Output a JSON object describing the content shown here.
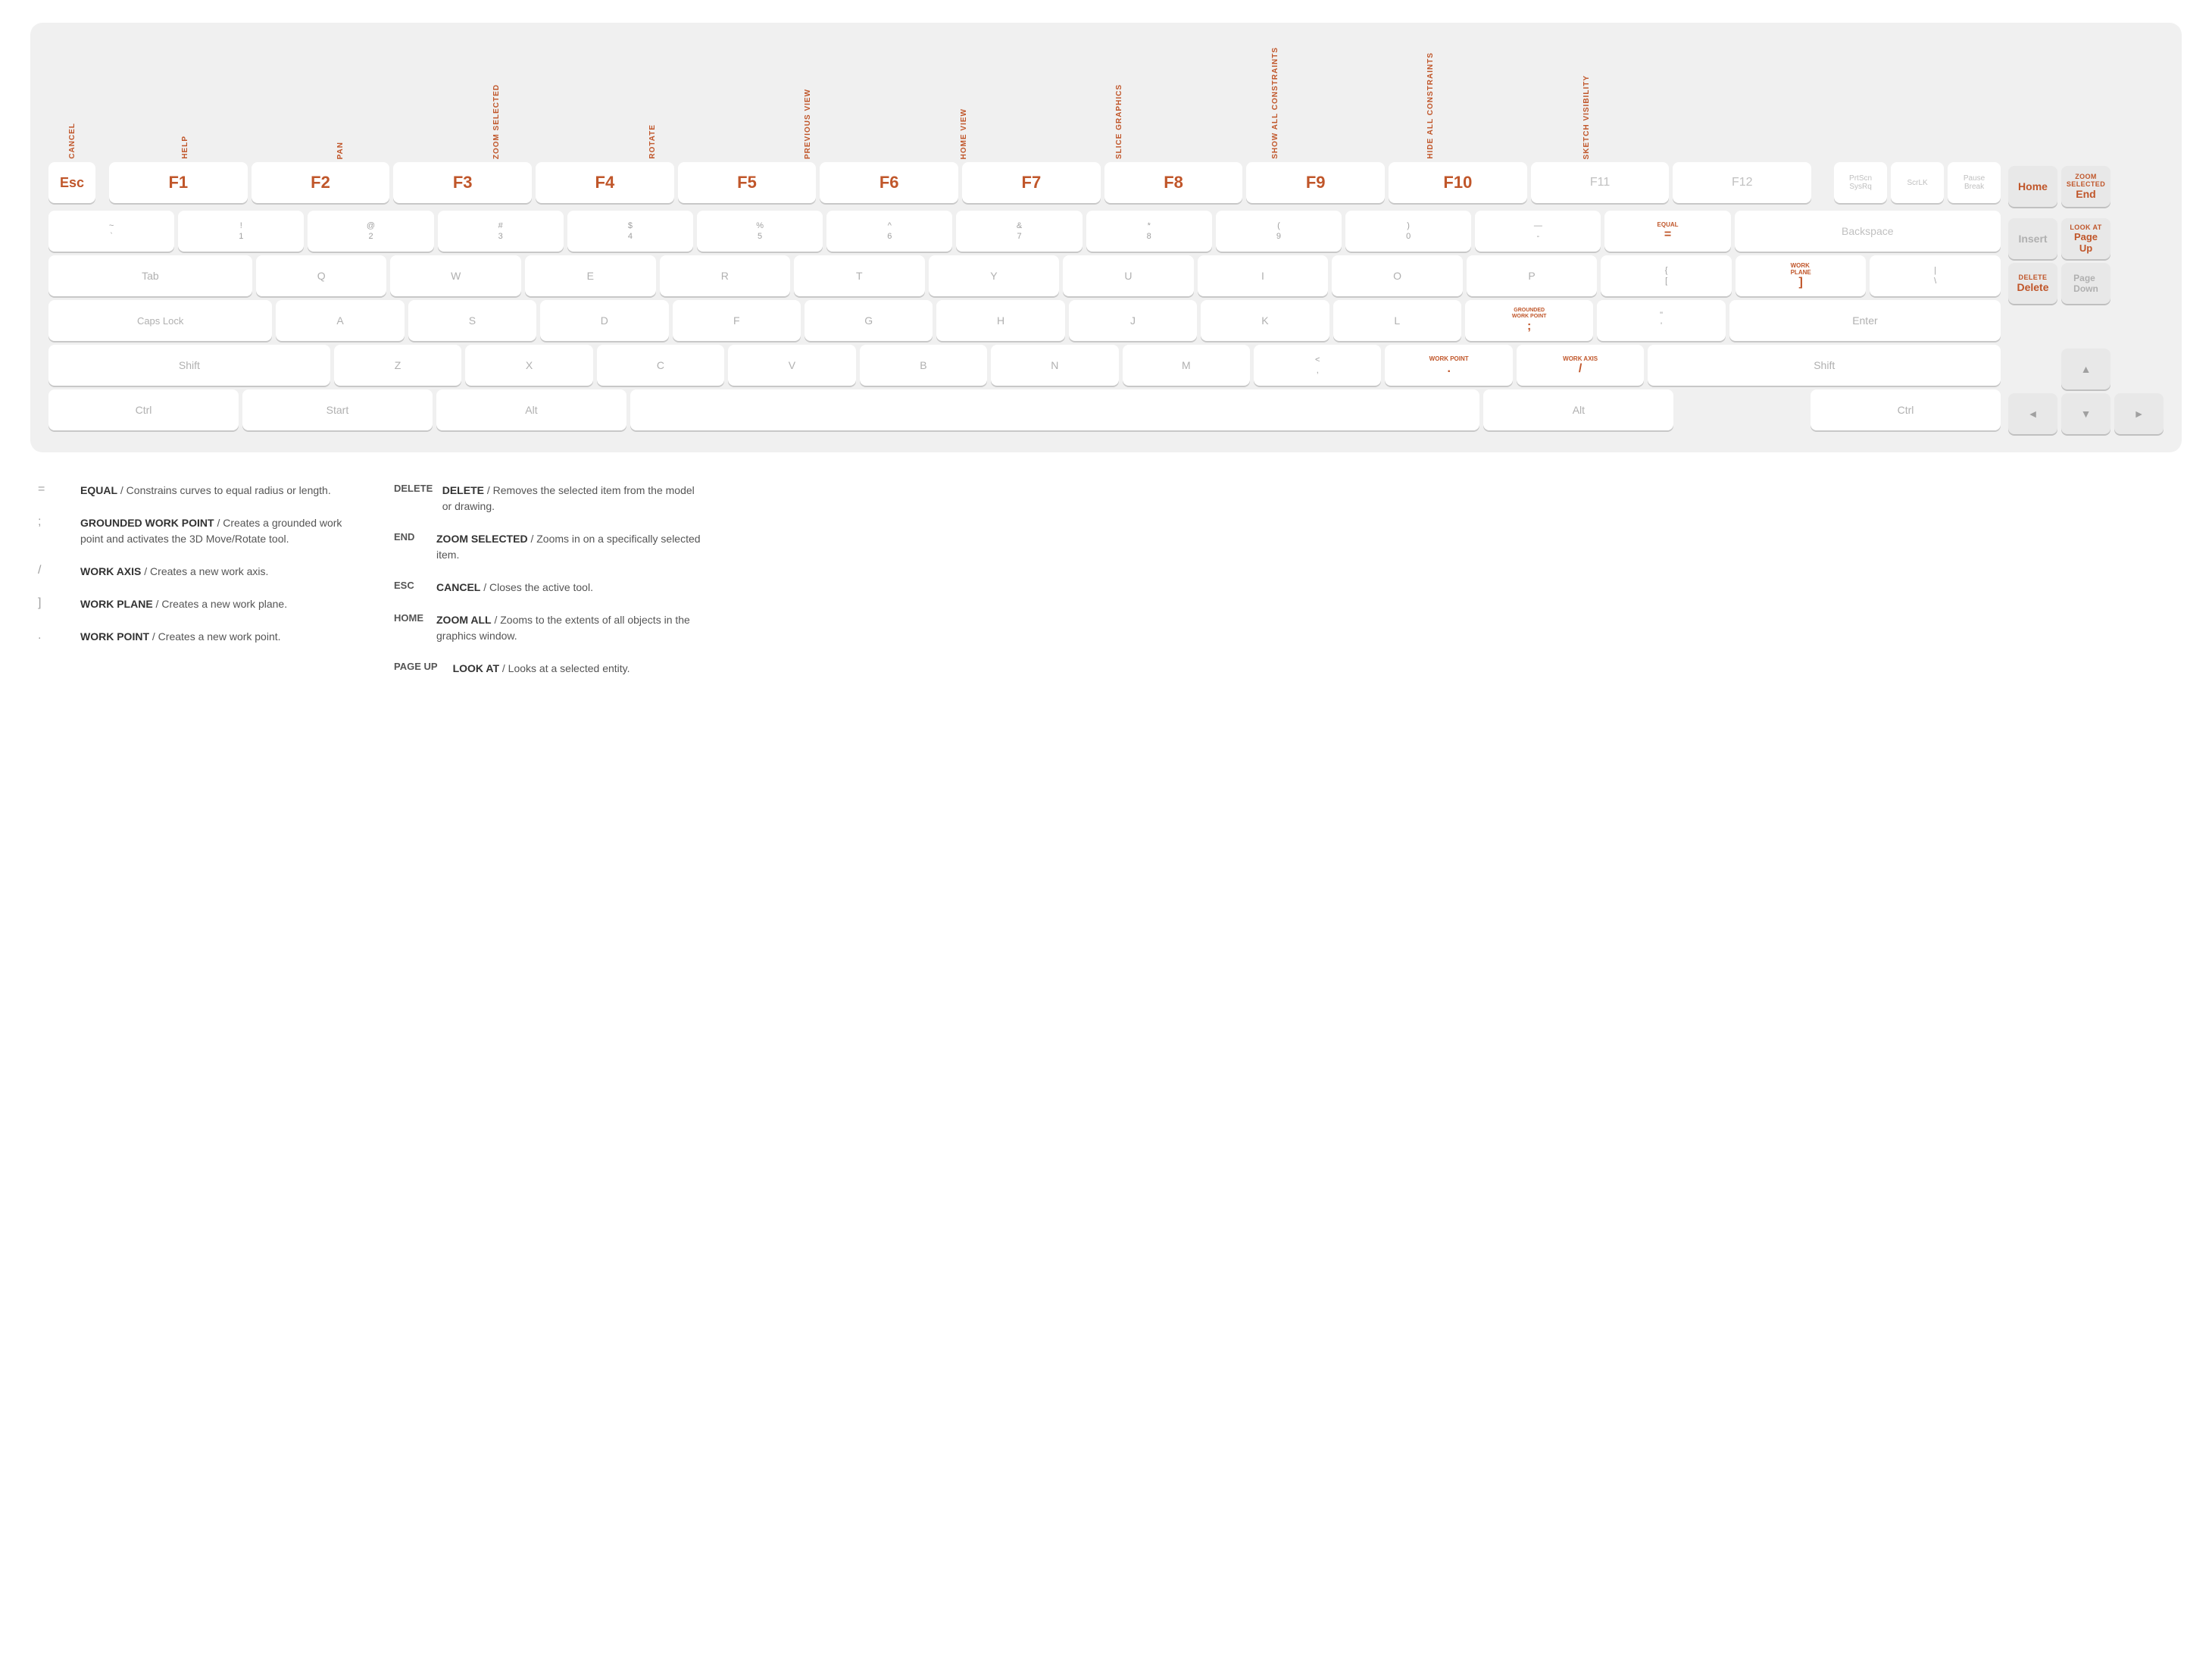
{
  "keyboard": {
    "function_row": {
      "labels": {
        "cancel": "CANCEL",
        "help": "HELP",
        "pan": "PAN",
        "zoom_selected": "ZOOM SELECTED",
        "rotate": "ROTATE",
        "previous_view": "PREVIOUS VIEW",
        "home_view": "HOME VIEW",
        "slice_graphics": "SLICE GRAPHICS",
        "show_all_constraints": "SHOW ALL CONSTRAINTS",
        "hide_all_constraints": "HIDE ALL CONSTRAINTS",
        "sketch_visibility": "SKETCH VISIBILITY"
      },
      "keys": [
        "Esc",
        "F1",
        "F2",
        "F3",
        "F4",
        "F5",
        "F6",
        "F7",
        "F8",
        "F9",
        "F10",
        "F11",
        "F12",
        "PrtScn SysRq",
        "ScrLK",
        "Pause Break"
      ]
    },
    "row1": {
      "keys": [
        "~\n`",
        "!\n1",
        "@\n2",
        "#\n3",
        "$\n4",
        "%\n5",
        "^\n6",
        "&\n7",
        "*\n8",
        "(\n9",
        ")\n0",
        "—\n-",
        "=",
        "Backspace"
      ],
      "equal_label": "EQUAL",
      "equal_sym": "="
    },
    "row2": {
      "keys": [
        "Tab",
        "Q",
        "W",
        "E",
        "R",
        "T",
        "Y",
        "U",
        "I",
        "O",
        "P",
        "[\n{",
        "]\n|",
        "\\n|"
      ]
    },
    "row3": {
      "keys": [
        "Caps Lock",
        "A",
        "S",
        "D",
        "F",
        "G",
        "H",
        "J",
        "K",
        "L",
        ";",
        "\"",
        "Enter"
      ]
    },
    "row4": {
      "keys": [
        "Shift",
        "Z",
        "X",
        "C",
        "V",
        "B",
        "N",
        "M",
        "<\n,",
        ".",
        "Shift"
      ]
    },
    "row5": {
      "keys": [
        "Ctrl",
        "Start",
        "Alt",
        "",
        "Alt",
        "",
        "Ctrl"
      ]
    },
    "side": {
      "top": [
        "Home",
        "End\nZOOM SELECTED"
      ],
      "mid_top": [
        "Insert",
        "Page Up\nLOOK AT"
      ],
      "mid": [
        "Delete\nDELETE",
        "Page Down"
      ],
      "arrows": [
        "▲",
        "◄",
        "▼",
        "►"
      ]
    },
    "special_keys": {
      "bracket_label": "WORK PLANE",
      "bracket_sym": "]",
      "semicolon_label": "GROUNDED WORK POINT",
      "semicolon_sym": ";",
      "dot_label": "WORK POINT",
      "dot_sym": ".",
      "slash_label": "WORK AXIS",
      "slash_sym": "/"
    }
  },
  "legend": {
    "col1": [
      {
        "key": "=",
        "name": "EQUAL",
        "desc": "Constrains curves to equal radius or length."
      },
      {
        "key": ";",
        "name": "GROUNDED WORK POINT",
        "desc": "Creates a grounded work point and activates the 3D Move/Rotate tool."
      },
      {
        "key": "/",
        "name": "WORK AXIS",
        "desc": "Creates a new work axis."
      },
      {
        "key": "]",
        "name": "WORK PLANE",
        "desc": "Creates a new work plane."
      },
      {
        "key": ".",
        "name": "WORK POINT",
        "desc": "Creates a new work point."
      }
    ],
    "col2": [
      {
        "key": "DELETE",
        "name": "DELETE",
        "desc": "Removes the selected item from the model or drawing."
      },
      {
        "key": "END",
        "name": "ZOOM SELECTED",
        "desc": "Zooms in on a specifically selected item."
      },
      {
        "key": "ESC",
        "name": "CANCEL",
        "desc": "Closes the active tool."
      },
      {
        "key": "HOME",
        "name": "ZOOM ALL",
        "desc": "Zooms to the extents of all objects in the graphics window."
      },
      {
        "key": "PAGE UP",
        "name": "LOOK AT",
        "desc": "Looks at a selected entity."
      }
    ]
  }
}
